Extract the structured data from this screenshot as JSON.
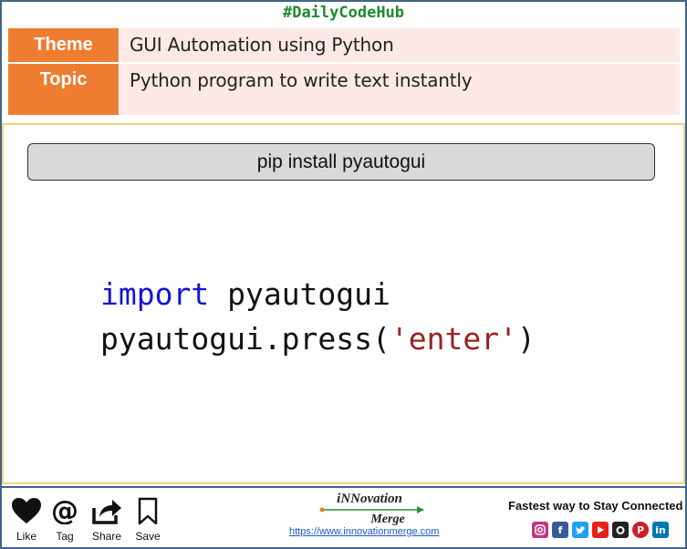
{
  "header": {
    "hashtag": "#DailyCodeHub"
  },
  "meta": {
    "theme_label": "Theme",
    "theme_value": "GUI Automation using Python",
    "topic_label": "Topic",
    "topic_value": "Python program to write text instantly"
  },
  "install": {
    "command": "pip install pyautogui"
  },
  "code": {
    "line1_keyword": "import",
    "line1_rest": " pyautogui",
    "line2_call": "pyautogui.press(",
    "line2_string": "'enter'",
    "line2_close": ")"
  },
  "footer": {
    "actions": [
      {
        "label": "Like",
        "icon": "heart-icon"
      },
      {
        "label": "Tag",
        "icon": "at-icon"
      },
      {
        "label": "Share",
        "icon": "share-icon"
      },
      {
        "label": "Save",
        "icon": "bookmark-icon"
      }
    ],
    "brand_line1": "iNNovation",
    "brand_line2": "Merge",
    "url": "https://www.innovationmerge.com",
    "connect_text": "Fastest way to Stay Connected",
    "socials": [
      {
        "icon": "instagram-icon",
        "color": "#c13584"
      },
      {
        "icon": "facebook-icon",
        "color": "#3b5998"
      },
      {
        "icon": "twitter-icon",
        "color": "#1da1f2"
      },
      {
        "icon": "youtube-icon",
        "color": "#e62117"
      },
      {
        "icon": "github-icon",
        "color": "#222222"
      },
      {
        "icon": "pinterest-icon",
        "color": "#cb2027"
      },
      {
        "icon": "linkedin-icon",
        "color": "#0077b5"
      }
    ]
  },
  "colors": {
    "accent_orange": "#ee7d31",
    "hashtag_green": "#1e8a2e",
    "keyword_blue": "#1414d8",
    "string_red": "#9c2121",
    "panel_border": "#f1d27a"
  }
}
